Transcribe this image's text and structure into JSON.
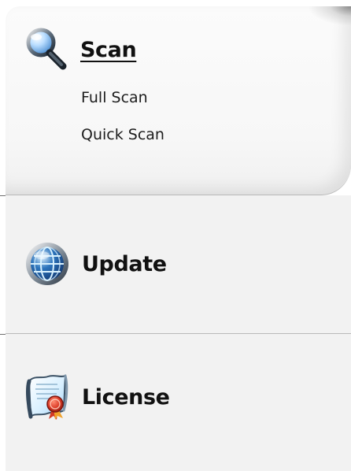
{
  "scan": {
    "title": "Scan",
    "icon": "magnifier-icon",
    "items": [
      {
        "label": "Full Scan"
      },
      {
        "label": "Quick Scan"
      }
    ]
  },
  "update": {
    "title": "Update",
    "icon": "globe-icon"
  },
  "license": {
    "title": "License",
    "icon": "certificate-icon"
  },
  "colors": {
    "panel_background": "#f2f2f2",
    "scan_background": "#f8f8f8",
    "divider": "#b9b9b9",
    "text": "#111111"
  }
}
